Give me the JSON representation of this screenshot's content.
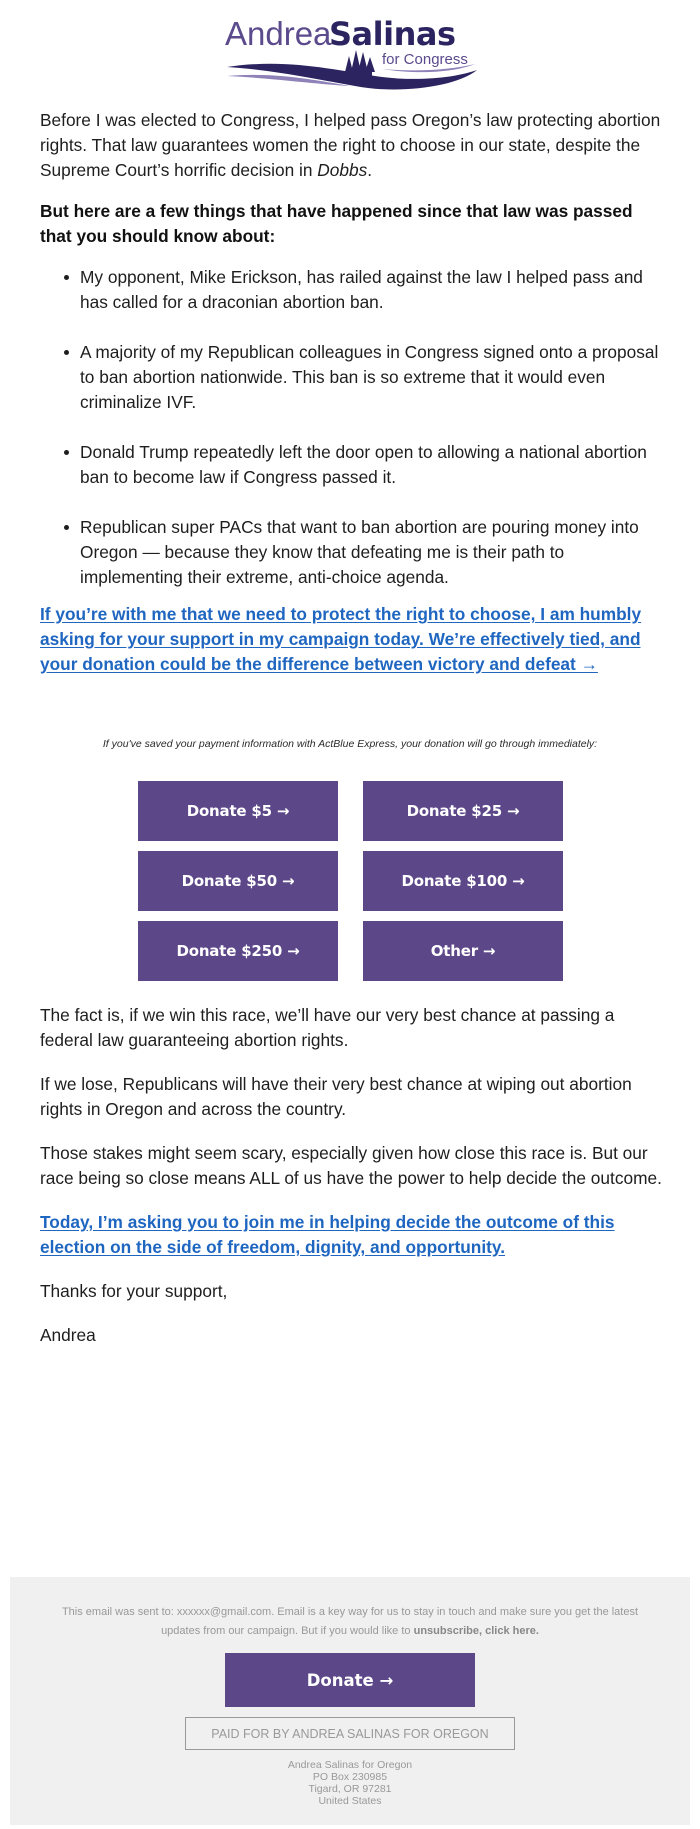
{
  "logo": {
    "first_name": "Andrea",
    "last_name": "Salinas",
    "tagline": "for Congress",
    "colors": {
      "light": "#5b4a8c",
      "dark": "#2b2460",
      "accent": "#8e82b8"
    }
  },
  "intro": {
    "paragraph_before_italic": "Before I was elected to Congress, I helped pass Oregon’s law protecting abortion rights. That law guarantees women the right to choose in our state, despite the Supreme Court’s horrific decision in ",
    "italic": "Dobbs",
    "paragraph_after_italic": ".",
    "bold_lead": "But here are a few things that have happened since that law was passed that you should know about:"
  },
  "bullets": [
    "My opponent, Mike Erickson, has railed against the law I helped pass and has called for a draconian abortion ban.",
    "A majority of my Republican colleagues in Congress signed onto a proposal to ban abortion nationwide. This ban is so extreme that it would even criminalize IVF.",
    "Donald Trump repeatedly left the door open to allowing a national abortion ban to become law if Congress passed it.",
    "Republican super PACs that want to ban abortion are pouring money into Oregon — because they know that defeating me is their path to implementing their extreme, anti-choice agenda."
  ],
  "cta_primary": "If you’re with me that we need to protect the right to choose, I am humbly asking for your support in my campaign today. We’re effectively tied, and your donation could be the difference between victory and defeat →",
  "express_note": "If you've saved your payment information with ActBlue Express, your donation will go through immediately:",
  "donate_buttons": [
    "Donate $5 →",
    "Donate $25 →",
    "Donate $50 →",
    "Donate $100 →",
    "Donate $250 →",
    "Other →"
  ],
  "body_paragraphs": [
    "The fact is, if we win this race, we’ll have our very best chance at passing a federal law guaranteeing abortion rights.",
    "If we lose, Republicans will have their very best chance at wiping out abortion rights in Oregon and across the country.",
    "Those stakes might seem scary, especially given how close this race is. But our race being so close means ALL of us have the power to help decide the outcome."
  ],
  "cta_secondary": "Today, I’m asking you to join me in helping decide the outcome of this election on the side of freedom, dignity, and opportunity.",
  "signoff": "Thanks for your support,",
  "signature": "Andrea",
  "footer": {
    "sent_to_prefix": "This email was sent to: ",
    "email": "xxxxxx@gmail.com",
    "sent_to_suffix": ". Email is a key way for us to stay in touch and make sure you get the latest updates from our campaign. But if you would like to ",
    "unsubscribe_label": "unsubscribe, click here.",
    "donate_label": "Donate →",
    "paid_for": "PAID FOR BY ANDREA SALINAS FOR OREGON",
    "address_lines": [
      "Andrea Salinas for Oregon",
      "PO Box 230985",
      "Tigard, OR 97281",
      "United States"
    ]
  },
  "colors": {
    "button_purple": "#5c4789",
    "link_blue": "#1f66c1",
    "footer_bg": "#f0f0f0",
    "footer_text": "#999999"
  }
}
